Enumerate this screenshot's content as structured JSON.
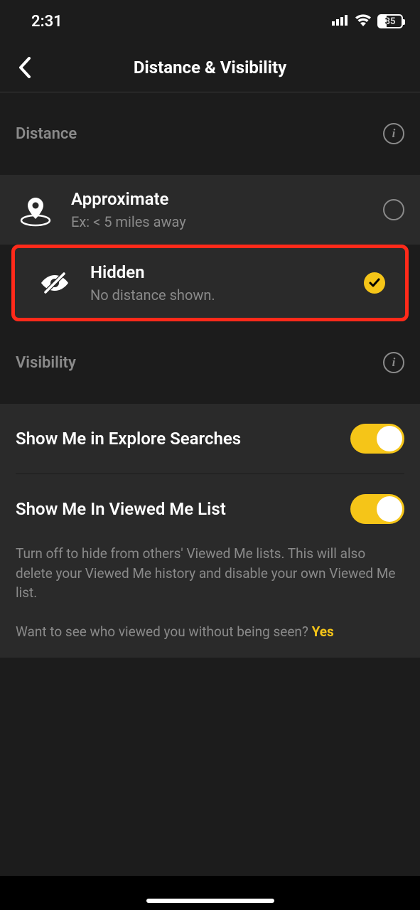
{
  "status": {
    "time": "2:31",
    "battery": "35"
  },
  "header": {
    "title": "Distance & Visibility"
  },
  "sections": {
    "distance": {
      "label": "Distance"
    },
    "visibility": {
      "label": "Visibility"
    }
  },
  "options": {
    "approximate": {
      "title": "Approximate",
      "sub": "Ex: < 5 miles away",
      "selected": false
    },
    "hidden": {
      "title": "Hidden",
      "sub": "No distance shown.",
      "selected": true
    }
  },
  "toggles": {
    "explore": {
      "label": "Show Me in Explore Searches",
      "on": true
    },
    "viewed": {
      "label": "Show Me In Viewed Me List",
      "on": true,
      "desc": "Turn off to hide from others' Viewed Me lists. This will also delete your Viewed Me history and disable your own Viewed Me list.",
      "prompt": "Want to see who viewed you without being seen? ",
      "yes": "Yes"
    }
  }
}
